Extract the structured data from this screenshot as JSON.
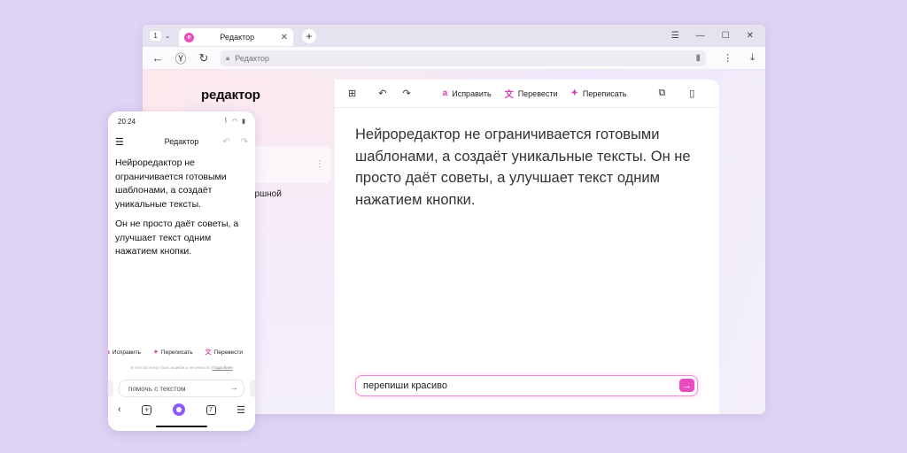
{
  "browser": {
    "tab_count": "1",
    "tab_title": "Редактор",
    "url": "Редактор"
  },
  "app": {
    "logo": "редактор",
    "sidebar_partial_text": "ершной",
    "toolbar": {
      "fix": "Исправить",
      "translate": "Перевести",
      "rewrite": "Переписать"
    },
    "document": [
      "Нейроредактор не ограничивается готовыми шаблонами, а создаёт уникальные тексты.",
      "Он не просто даёт советы, а улучшает текст одним нажатием кнопки."
    ],
    "prompt_value": "перепиши красиво"
  },
  "phone": {
    "time": "20:24",
    "title": "Редактор",
    "paragraphs": [
      "Нейроредактор не ограничивается готовыми шаблонами, а создаёт уникальные тексты.",
      "Он не просто даёт советы, а улучшает текст одним нажатием кнопки."
    ],
    "actions": {
      "fix": "Исправить",
      "rewrite": "Переписать",
      "translate": "Перевести"
    },
    "note": "В текстах могут быть ошибки и неточности.",
    "note_link": "Подробнее",
    "input_placeholder": "помочь с текстом",
    "tabs_count": "7"
  },
  "colors": {
    "background": "#ddd3f3",
    "accent": "#e94dbd"
  }
}
